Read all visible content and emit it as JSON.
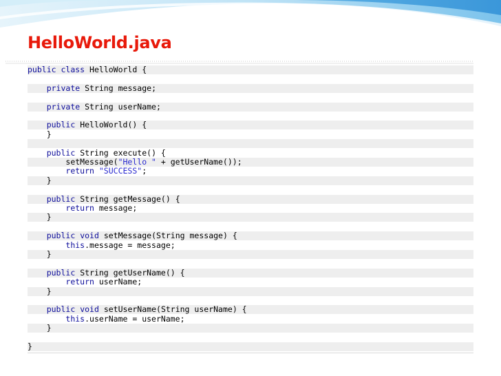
{
  "slide": {
    "title": "HelloWorld.java"
  },
  "colors": {
    "title": "#e8190a",
    "keyword": "#0b0b9a",
    "string": "#2a2ad0",
    "wave": "#3fa3df",
    "shade": "#eeeeee"
  },
  "code": {
    "language": "java",
    "lines": [
      "public class HelloWorld {",
      "",
      "    private String message;",
      "",
      "    private String userName;",
      "",
      "    public HelloWorld() {",
      "    }",
      "",
      "    public String execute() {",
      "        setMessage(\"Hello \" + getUserName());",
      "        return \"SUCCESS\";",
      "    }",
      "",
      "    public String getMessage() {",
      "        return message;",
      "    }",
      "",
      "    public void setMessage(String message) {",
      "        this.message = message;",
      "    }",
      "",
      "    public String getUserName() {",
      "        return userName;",
      "    }",
      "",
      "    public void setUserName(String userName) {",
      "        this.userName = userName;",
      "    }",
      "",
      "}"
    ]
  }
}
